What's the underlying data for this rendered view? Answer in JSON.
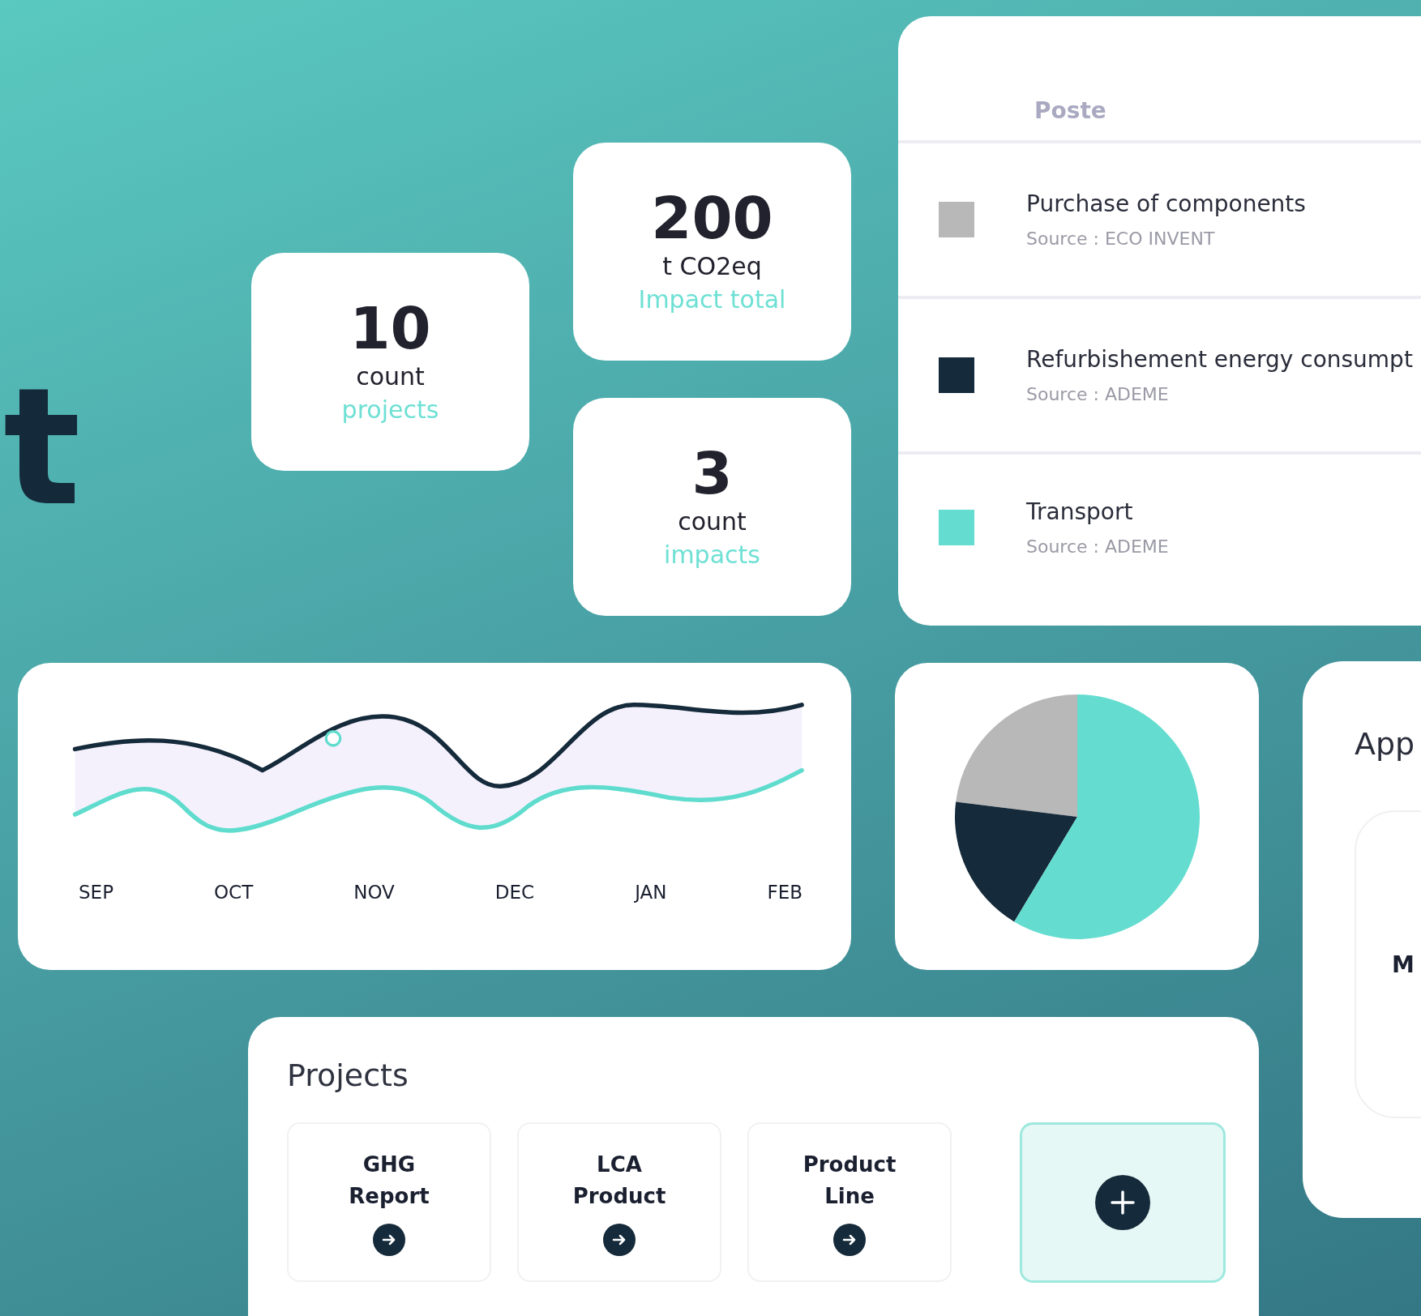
{
  "hero_text": "t",
  "stats": [
    {
      "value": "10",
      "unit": "count",
      "label": "projects"
    },
    {
      "value": "200",
      "unit": "t CO2eq",
      "label": "Impact total"
    },
    {
      "value": "3",
      "unit": "count",
      "label": "impacts"
    }
  ],
  "emissions_table": {
    "column": "Poste",
    "rows": [
      {
        "name": "Purchase of components",
        "source": "Source : ECO INVENT",
        "color": "#b8b8b8"
      },
      {
        "name": "Refurbishement energy consumpt",
        "source": "Source : ADEME",
        "color": "#152a3a"
      },
      {
        "name": "Transport",
        "source": "Source : ADEME",
        "color": "#64ddd0"
      }
    ]
  },
  "line_chart": {
    "months": [
      "SEP",
      "OCT",
      "NOV",
      "DEC",
      "JAN",
      "FEB"
    ]
  },
  "app_card": {
    "title": "App",
    "item_label": "M"
  },
  "projects": {
    "title": "Projects",
    "items": [
      {
        "name": "GHG Report"
      },
      {
        "name": "LCA Product"
      },
      {
        "name": "Product Line"
      }
    ]
  }
}
